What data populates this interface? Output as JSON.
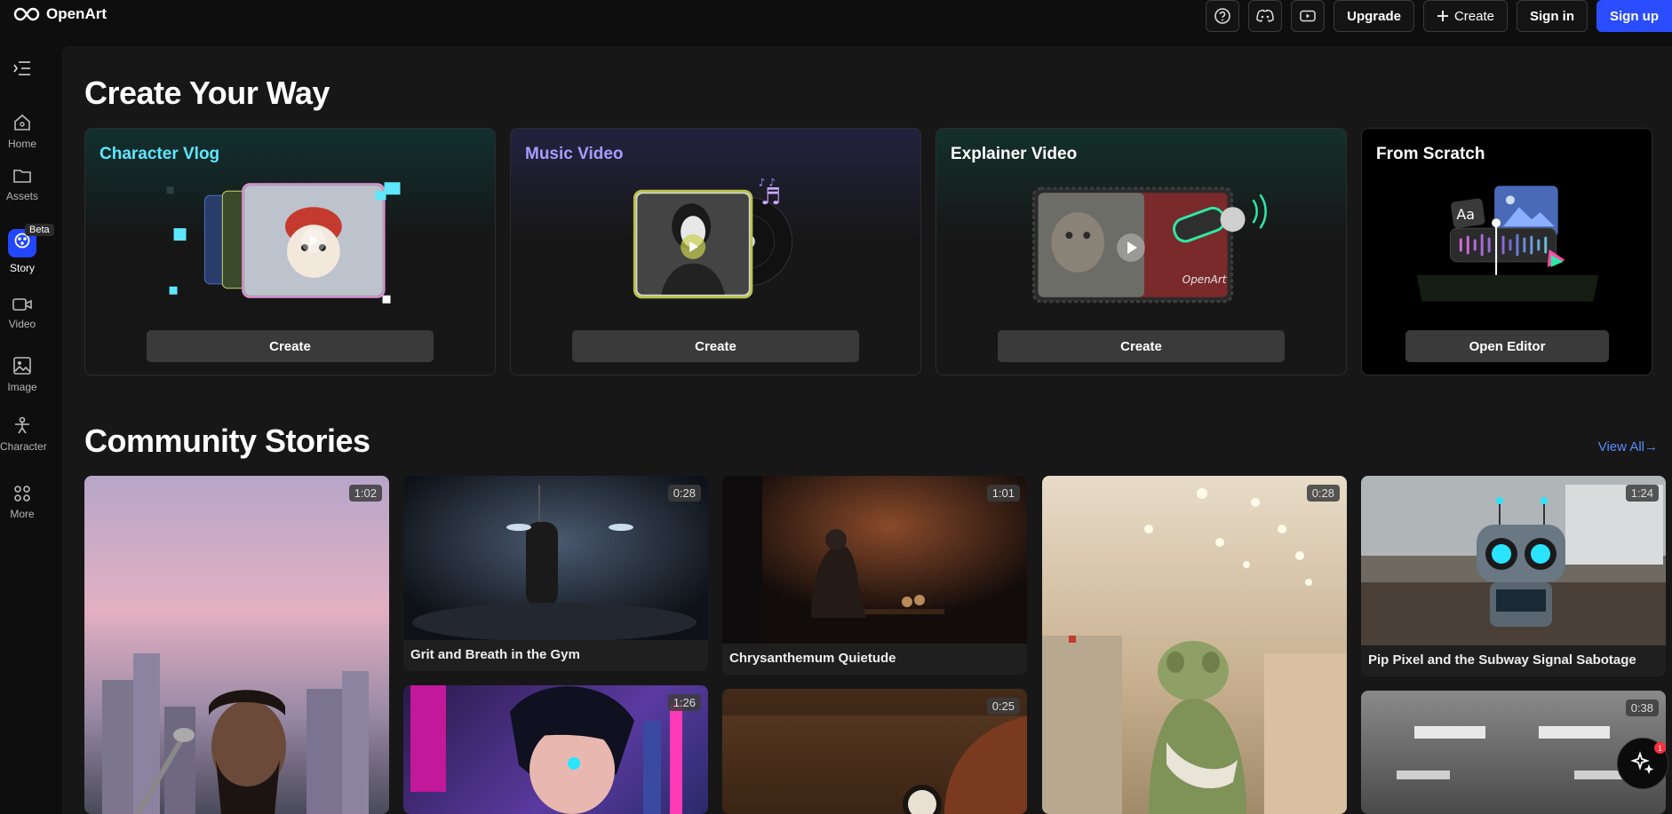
{
  "header": {
    "logo_text": "OpenArt",
    "upgrade_label": "Upgrade",
    "create_label": "Create",
    "signin_label": "Sign in",
    "signup_label": "Sign up",
    "icons": [
      "help-icon",
      "discord-icon",
      "youtube-icon"
    ]
  },
  "sidebar": {
    "items": [
      {
        "label": "Home",
        "icon": "home-icon"
      },
      {
        "label": "Assets",
        "icon": "folder-icon"
      },
      {
        "label": "Story",
        "icon": "story-icon",
        "badge": "Beta"
      },
      {
        "label": "Video",
        "icon": "video-icon"
      },
      {
        "label": "Image",
        "icon": "image-icon"
      },
      {
        "label": "Character",
        "icon": "character-icon"
      },
      {
        "label": "More",
        "icon": "more-icon"
      }
    ]
  },
  "create_section": {
    "title": "Create Your Way",
    "cards": [
      {
        "title": "Character Vlog",
        "button": "Create",
        "title_color": "#5ee7ff"
      },
      {
        "title": "Music Video",
        "button": "Create",
        "title_color": "#a99bff"
      },
      {
        "title": "Explainer Video",
        "button": "Create",
        "title_color": "#ffffff"
      },
      {
        "title": "From Scratch",
        "button": "Open Editor",
        "title_color": "#ffffff"
      }
    ]
  },
  "community": {
    "title": "Community Stories",
    "view_all": "View All→",
    "stories": [
      {
        "title": "",
        "duration": "1:02"
      },
      {
        "title": "Grit and Breath in the Gym",
        "duration": "0:28"
      },
      {
        "title": "",
        "duration": "1:26"
      },
      {
        "title": "Chrysanthemum Quietude",
        "duration": "1:01"
      },
      {
        "title": "",
        "duration": "0:25"
      },
      {
        "title": "",
        "duration": "0:28"
      },
      {
        "title": "Pip Pixel and the Subway Signal Sabotage",
        "duration": "1:24"
      },
      {
        "title": "",
        "duration": "0:38"
      }
    ]
  },
  "fab": {
    "badge": "1"
  },
  "colors": {
    "accent": "#2a4dff",
    "link": "#5b8cff"
  }
}
